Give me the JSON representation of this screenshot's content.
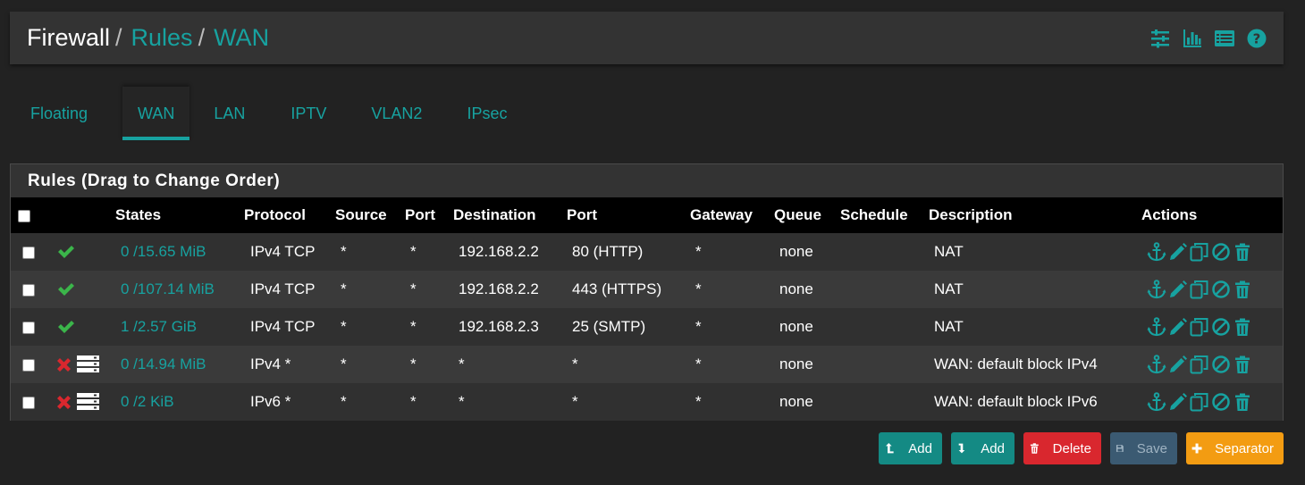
{
  "breadcrumb": {
    "root": "Firewall",
    "sep": "/",
    "rules": "Rules",
    "iface": "WAN"
  },
  "header_icons": [
    "sliders-icon",
    "bar-chart-icon",
    "list-icon",
    "help-icon"
  ],
  "tabs": [
    {
      "label": "Floating",
      "active": false
    },
    {
      "label": "WAN",
      "active": true
    },
    {
      "label": "LAN",
      "active": false
    },
    {
      "label": "IPTV",
      "active": false
    },
    {
      "label": "VLAN2",
      "active": false
    },
    {
      "label": "IPsec",
      "active": false
    }
  ],
  "panel": {
    "title": "Rules (Drag to Change Order)"
  },
  "columns": {
    "states": "States",
    "protocol": "Protocol",
    "source": "Source",
    "port": "Port",
    "destination": "Destination",
    "dport": "Port",
    "gateway": "Gateway",
    "queue": "Queue",
    "schedule": "Schedule",
    "description": "Description",
    "actions": "Actions"
  },
  "rows": [
    {
      "status": "pass",
      "states": "0 /15.65 MiB",
      "protocol": "IPv4 TCP",
      "source": "*",
      "port": "*",
      "destination": "192.168.2.2",
      "dport": "80 (HTTP)",
      "gateway": "*",
      "queue": "none",
      "schedule": "",
      "description": "NAT"
    },
    {
      "status": "pass",
      "states": "0 /107.14 MiB",
      "protocol": "IPv4 TCP",
      "source": "*",
      "port": "*",
      "destination": "192.168.2.2",
      "dport": "443 (HTTPS)",
      "gateway": "*",
      "queue": "none",
      "schedule": "",
      "description": "NAT"
    },
    {
      "status": "pass",
      "states": "1 /2.57 GiB",
      "protocol": "IPv4 TCP",
      "source": "*",
      "port": "*",
      "destination": "192.168.2.3",
      "dport": "25 (SMTP)",
      "gateway": "*",
      "queue": "none",
      "schedule": "",
      "description": "NAT"
    },
    {
      "status": "block",
      "states": "0 /14.94 MiB",
      "protocol": "IPv4 *",
      "source": "*",
      "port": "*",
      "destination": "*",
      "dport": "*",
      "gateway": "*",
      "queue": "none",
      "schedule": "",
      "description": "WAN: default block IPv4"
    },
    {
      "status": "block",
      "states": "0 /2 KiB",
      "protocol": "IPv6 *",
      "source": "*",
      "port": "*",
      "destination": "*",
      "dport": "*",
      "gateway": "*",
      "queue": "none",
      "schedule": "",
      "description": "WAN: default block IPv6"
    }
  ],
  "buttons": {
    "add_top": "Add",
    "add_bottom": "Add",
    "delete": "Delete",
    "save": "Save",
    "separator": "Separator"
  },
  "colors": {
    "accent": "#17a2a0",
    "pass": "#3bb54a",
    "block": "#d9272e",
    "danger": "#d9272e",
    "warning": "#f39c12",
    "save": "#3b5a72",
    "teal_button": "#148a84"
  }
}
